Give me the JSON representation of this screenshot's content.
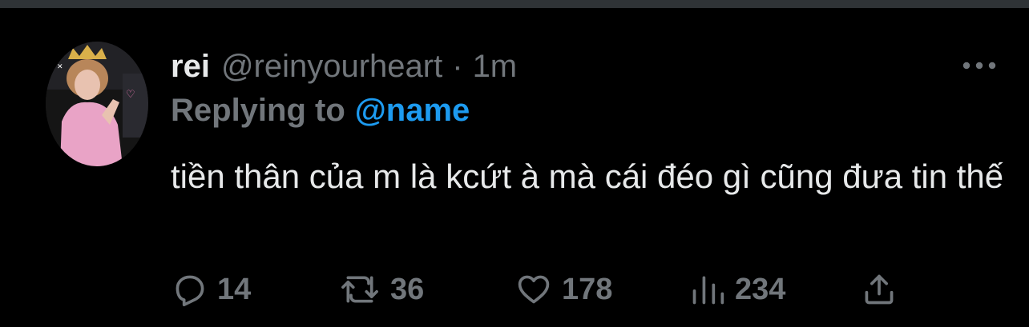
{
  "tweet": {
    "display_name": "rei",
    "handle": "@reinyourheart",
    "separator": "·",
    "time": "1m",
    "replying_label": "Replying to",
    "replying_to": "@name",
    "text": "tiền thân của m là kcứt à mà cái đéo gì cũng đưa tin thế"
  },
  "actions": {
    "replies": {
      "icon": "reply-icon",
      "count": "14"
    },
    "retweets": {
      "icon": "retweet-icon",
      "count": "36"
    },
    "likes": {
      "icon": "heart-icon",
      "count": "178"
    },
    "views": {
      "icon": "views-icon",
      "count": "234"
    },
    "share": {
      "icon": "share-icon"
    }
  },
  "colors": {
    "background": "#000000",
    "primary_text": "#e7e9ea",
    "secondary_text": "#71767b",
    "accent": "#1d9bf0",
    "divider": "#2f3336"
  }
}
